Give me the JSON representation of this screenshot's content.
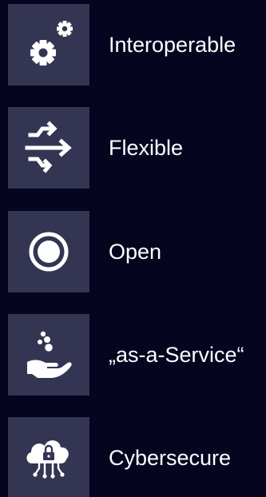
{
  "background": "#050520",
  "tile_color": "#333552",
  "features": [
    {
      "icon": "gears-icon",
      "label": "Interoperable"
    },
    {
      "icon": "flow-arrows-icon",
      "label": "Flexible"
    },
    {
      "icon": "open-circle-icon",
      "label": "Open"
    },
    {
      "icon": "hand-service-icon",
      "label": "„as-a-Service“"
    },
    {
      "icon": "cloud-lock-icon",
      "label": "Cybersecure"
    }
  ]
}
